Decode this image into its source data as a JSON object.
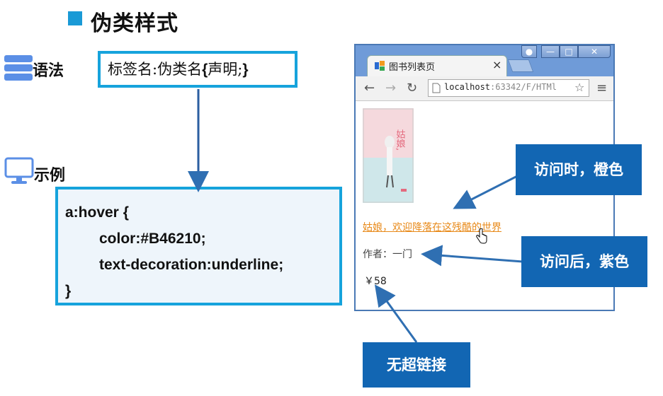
{
  "slide": {
    "title": "伪类样式",
    "syntax_label": "语法",
    "example_label": "示例"
  },
  "syntax": {
    "text_a": "标签名:伪类名",
    "text_b": "{",
    "text_c": "声明;",
    "text_d": "}"
  },
  "code": {
    "line1": "a:hover {",
    "line2": "color:#B46210;",
    "line3": "text-decoration:underline;",
    "line4": "}"
  },
  "browser": {
    "tab_title": "图书列表页",
    "tab_close": "×",
    "url_host": "localhost",
    "url_rest": ":63342/F/HTMl",
    "book_link": "姑娘，欢迎降落在这残酷的世界",
    "author": "作者：一门",
    "price": "￥58",
    "cover_title": "姑娘,"
  },
  "callouts": {
    "hover": "访问时，橙色",
    "visited": "访问后，紫色",
    "nolink": "无超链接"
  },
  "colors": {
    "accent": "#1a9ad6",
    "box_border": "#16a3dc",
    "callout_bg": "#1266b3",
    "link_hover": "#e88a1a"
  },
  "icons": [
    "server-stack-icon",
    "monitor-icon",
    "back-icon",
    "forward-icon",
    "reload-icon",
    "page-icon",
    "star-icon",
    "menu-icon",
    "hand-cursor-icon"
  ]
}
